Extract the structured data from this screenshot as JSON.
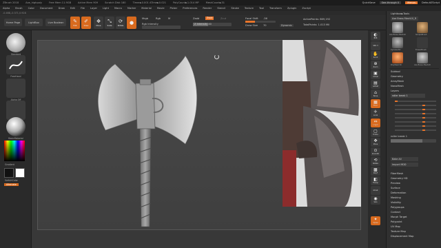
{
  "titlebar": {
    "app": "ZBrush 2018",
    "file": "Axe_highpoly",
    "free_mem": "Free Mem 11.9GB",
    "active_mem": "Active Mem 909",
    "scratch_disk": "Scratch Disk 180",
    "timer": "Timer►0.001 ATime►0.021",
    "poly_count": "PolyCount►1.014 MP",
    "mesh_count": "MeshCount►31",
    "quicksave": "QuickSave",
    "see_through": "See-through 0",
    "menus_label": "Menus",
    "default_script": "DefaultZScript"
  },
  "menu": [
    "Alpha",
    "Brush",
    "Color",
    "Document",
    "Draw",
    "Edit",
    "File",
    "Layer",
    "Light",
    "Macro",
    "Marker",
    "Material",
    "Movie",
    "Picker",
    "Preferences",
    "Render",
    "Stencil",
    "Stroke",
    "Texture",
    "Tool",
    "Transform",
    "Zplugin",
    "Zscript"
  ],
  "coords": "-0.468,-0.371,0.928",
  "toolbar": {
    "home_page": "Home Page",
    "lightbox": "LightBox",
    "live_boolean": "Live Boolean",
    "edit": "Edit",
    "draw": "Draw",
    "move": "Move",
    "scale": "Scale",
    "rotate": "Rotate",
    "mrgb": "Mrgb",
    "rgb": "Rgb",
    "m": "M",
    "rgb_intensity": "Rgb Intensity",
    "zadd": "Zadd",
    "zsub": "Zsub",
    "zcut": "Zcut",
    "z_intensity": "Z Intensity 40",
    "focal_shift": "Focal Shift",
    "focal_shift_val": "-36",
    "draw_size": "Draw Size",
    "draw_size_val": "70",
    "dynamic": "Dynamic",
    "active_points": "ActivePoints: 869,192",
    "total_points": "TotalPoints: 1.013 Mil"
  },
  "leftshelf": {
    "brush_label": "Standard",
    "stroke_label": "FreeHand",
    "alpha_label": "Alpha Off",
    "texture_label": "Texture Off",
    "material_label": "BasicMaterial",
    "gradient_label": "Gradient",
    "switch_color": "SwitchColor",
    "alternate": "Alternate"
  },
  "rightscroll": [
    "BPR",
    "SPix 3",
    "Scroll",
    "Zoom",
    "Actual",
    "AAHalf",
    "Persp",
    "Floor",
    "Local",
    "L.Sym",
    "Frame",
    "Move",
    "Zoom3D",
    "Rotate",
    "PolyF",
    "Transp",
    "Ghost",
    "Solo",
    "Xpose"
  ],
  "tray": {
    "lightbox_title": "Lightbox►Tools",
    "axe_brush_label": "Axe Brass Mesh10_R",
    "brush_captions": [
      "Axe Brass Mesh10",
      "SimpleBrush",
      "Cylinder3D",
      "EraserBrush",
      "PolyMesh3D",
      "Axe Brass Mesh10"
    ],
    "items": [
      "Subtool",
      "Geometry",
      "ArrayMesh",
      "NanoMesh",
      "Layers"
    ],
    "layer_name": "roller break 1",
    "layer_name2": "roller break 1",
    "bake_all": "Bake All",
    "import_mdd": "Import MDD",
    "items2": [
      "FiberMesh",
      "Geometry HD",
      "Preview",
      "Surface",
      "Deformation",
      "Masking",
      "Visibility",
      "Polygroups",
      "Contact",
      "Morph Target",
      "Polypaint",
      "UV Map",
      "Texture Map",
      "Displacement Map"
    ]
  },
  "colors": {
    "accent": "#e8742a",
    "panel": "#303030",
    "canvas": "#464646"
  }
}
